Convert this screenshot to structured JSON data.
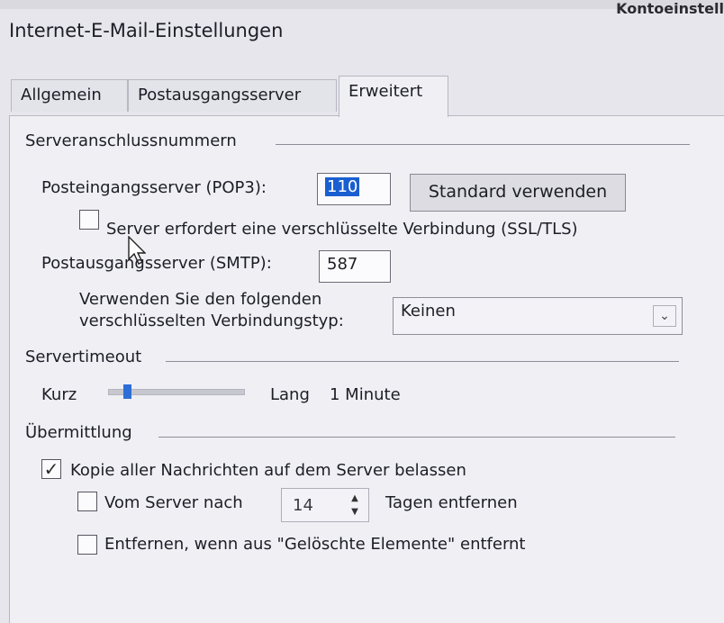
{
  "window": {
    "title": "Internet-E-Mail-Einstellungen",
    "background_window_title": "Kontoeinstell"
  },
  "tabs": [
    {
      "label": "Allgemein",
      "active": false
    },
    {
      "label": "Postausgangsserver",
      "active": false
    },
    {
      "label": "Erweitert",
      "active": true
    }
  ],
  "server_ports": {
    "group_title": "Serveranschlussnummern",
    "incoming_label": "Posteingangsserver (POP3):",
    "incoming_value": "110",
    "default_button": "Standard verwenden",
    "ssl_checkbox_label": "Server erfordert eine verschlüsselte Verbindung (SSL/TLS)",
    "ssl_checked": false,
    "outgoing_label": "Postausgangsserver (SMTP):",
    "outgoing_value": "587",
    "encryption_label_line1": "Verwenden Sie den folgenden",
    "encryption_label_line2": "verschlüsselten Verbindungstyp:",
    "encryption_value": "Keinen"
  },
  "timeout": {
    "group_title": "Servertimeout",
    "short_label": "Kurz",
    "long_label": "Lang",
    "value_label": "1 Minute",
    "slider_fraction": 0.1
  },
  "delivery": {
    "group_title": "Übermittlung",
    "keep_copy_label": "Kopie aller Nachrichten auf dem Server belassen",
    "keep_copy_checked": true,
    "remove_after_label_prefix": "Vom Server nach",
    "remove_after_days": "14",
    "remove_after_label_suffix": "Tagen entfernen",
    "remove_after_checked": false,
    "remove_deleted_label": "Entfernen, wenn aus \"Gelöschte Elemente\" entfernt",
    "remove_deleted_checked": false
  }
}
